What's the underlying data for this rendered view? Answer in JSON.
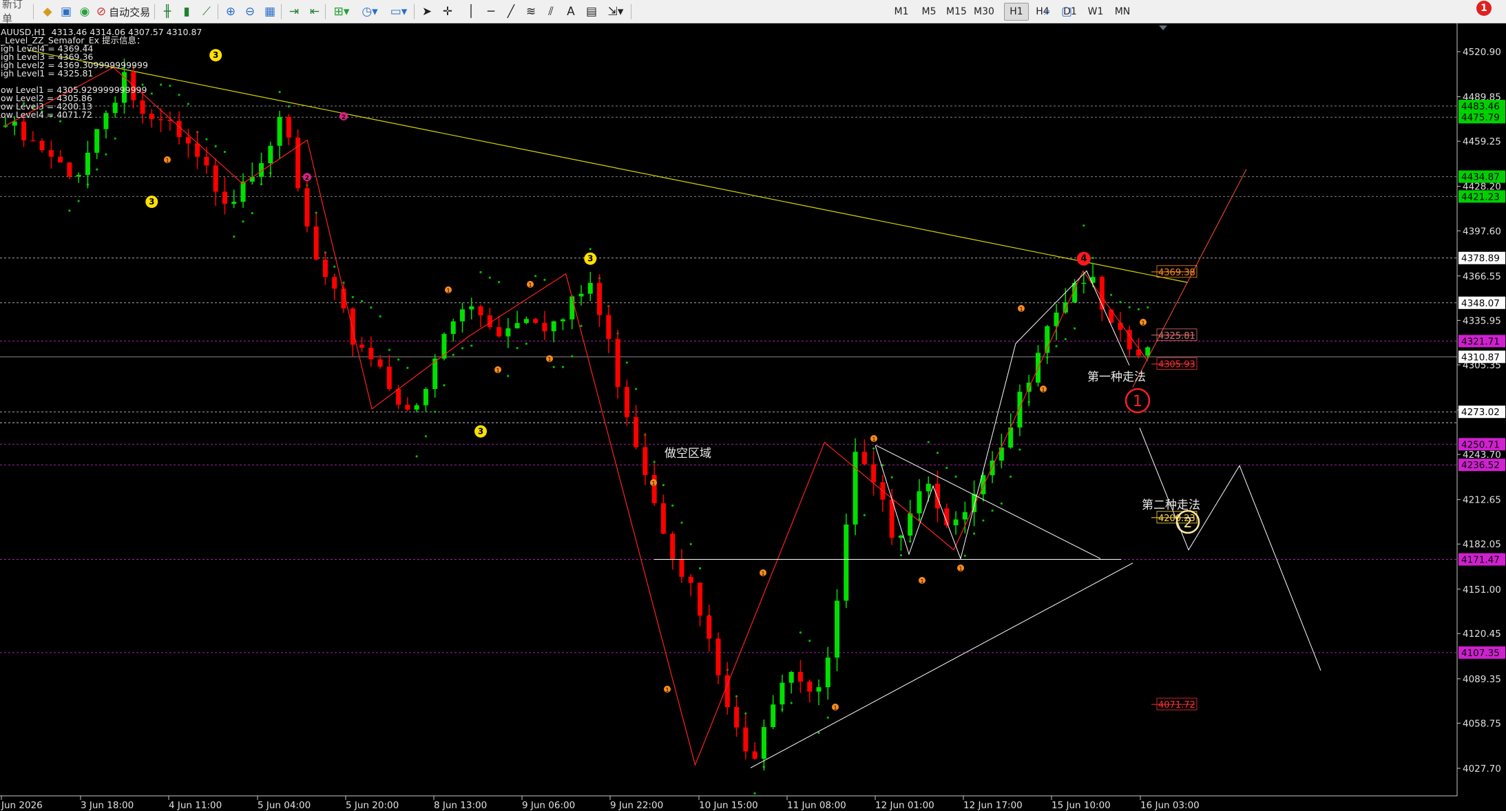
{
  "toolbar": {
    "new_order": "新订单",
    "auto_trading": "自动交易",
    "timeframes": [
      "M1",
      "M5",
      "M15",
      "M30",
      "H1",
      "H4",
      "D1",
      "W1",
      "MN"
    ],
    "active_timeframe": "H1",
    "alert_count": "1",
    "icons": [
      "new-order-icon",
      "metaeditor-icon",
      "navigator-icon",
      "market-watch-icon",
      "auto-trading-icon",
      "bar-chart-icon",
      "candlestick-icon",
      "line-chart-icon",
      "zoom-in-icon",
      "zoom-out-icon",
      "tile-icon",
      "chart-shift-icon",
      "autoscroll-icon",
      "indicators-icon",
      "periods-icon",
      "templates-icon",
      "cursor-icon",
      "crosshair-icon",
      "vertical-line-icon",
      "horizontal-line-icon",
      "trendline-icon",
      "fibo-icon",
      "channel-icon",
      "text-icon",
      "label-icon",
      "arrows-icon",
      "search-icon",
      "chat-icon"
    ]
  },
  "chart_header": {
    "symbol_line": "AUUSD,H1  4313.46 4314.06 4307.57 4310.87",
    "indicator_name": "_Level_ZZ_Semafor_Ex 提示信息：",
    "levels": [
      "igh Level4 = 4369.44",
      "igh Level3 = 4369.36",
      "igh Level2 = 4369.309999999999",
      "igh Level1 = 4325.81",
      "",
      "ow Level1 = 4305.929999999999",
      "ow Level2 = 4305.86",
      "ow Level3 = 4200.13",
      "ow Level4 = 4071.72"
    ]
  },
  "price_axis": {
    "ticks": [
      "4520.90",
      "4489.85",
      "4459.25",
      "4428.20",
      "4397.60",
      "4366.55",
      "4335.95",
      "4305.35",
      "4274.30",
      "4243.70",
      "4212.65",
      "4182.05",
      "4151.00",
      "4120.45",
      "4089.35",
      "4058.75",
      "4027.70"
    ],
    "tick_values": [
      4520.9,
      4489.85,
      4459.25,
      4428.2,
      4397.6,
      4366.55,
      4335.95,
      4305.35,
      4274.3,
      4243.7,
      4212.65,
      4182.05,
      4151.0,
      4120.45,
      4089.35,
      4058.75,
      4027.7
    ],
    "tags": [
      {
        "text": "4483.46",
        "value": 4483.46,
        "color": "#00d000"
      },
      {
        "text": "4475.79",
        "value": 4475.79,
        "color": "#00d000"
      },
      {
        "text": "4434.87",
        "value": 4434.87,
        "color": "#00d000"
      },
      {
        "text": "4421.23",
        "value": 4421.23,
        "color": "#00d000"
      },
      {
        "text": "4378.89",
        "value": 4378.89,
        "color": "#ffffff"
      },
      {
        "text": "4348.07",
        "value": 4348.07,
        "color": "#ffffff"
      },
      {
        "text": "4321.71",
        "value": 4321.71,
        "color": "#d020d0"
      },
      {
        "text": "4310.87",
        "value": 4310.87,
        "color": "#ffffff"
      },
      {
        "text": "4273.02",
        "value": 4273.02,
        "color": "#ffffff"
      },
      {
        "text": "4250.71",
        "value": 4250.71,
        "color": "#d020d0"
      },
      {
        "text": "4236.52",
        "value": 4236.52,
        "color": "#d020d0"
      },
      {
        "text": "4171.47",
        "value": 4171.47,
        "color": "#d020d0"
      },
      {
        "text": "4107.35",
        "value": 4107.35,
        "color": "#d020d0"
      }
    ]
  },
  "time_axis": {
    "labels": [
      "Jun 2026",
      "3 Jun 18:00",
      "4 Jun 11:00",
      "5 Jun 04:00",
      "5 Jun 20:00",
      "8 Jun 13:00",
      "9 Jun 06:00",
      "9 Jun 22:00",
      "10 Jun 15:00",
      "11 Jun 08:00",
      "12 Jun 01:00",
      "12 Jun 17:00",
      "15 Jun 10:00",
      "16 Jun 03:00"
    ]
  },
  "level_boxes": [
    {
      "text": "4369.38",
      "value": 4369.38,
      "color": "#ff8c1a"
    },
    {
      "text": "4325.81",
      "value": 4325.81,
      "color": "#e07070"
    },
    {
      "text": "4305.93",
      "value": 4305.93,
      "color": "#ff3030"
    },
    {
      "text": "4200.23",
      "value": 4200.23,
      "color": "#ffd84a"
    },
    {
      "text": "4071.72",
      "value": 4071.72,
      "color": "#ff3030"
    }
  ],
  "annotations": {
    "short_zone": "做空区域",
    "scenario_one": "第一种走法",
    "scenario_two": "第二种走法",
    "marker_one": "1",
    "marker_two": "2"
  },
  "semafor_labels": [
    "1",
    "2",
    "3",
    "4"
  ],
  "colors": {
    "background": "#000000",
    "bull_candle": "#00e000",
    "bear_candle": "#ff0000",
    "grid_dotted": "#c8c8c8",
    "magenta_level": "#d020d0",
    "trendline": "#d8d800",
    "zigzag": "#ff2020",
    "projection_white": "#ffffff",
    "parabolic_sar": "#00c000"
  },
  "chart_data": {
    "type": "candlestick",
    "symbol": "AUUSD",
    "timeframe": "H1",
    "current_price": 4310.87,
    "ylim": [
      4018,
      4532
    ],
    "x_labels": [
      "Jun 2026",
      "3 Jun 18:00",
      "4 Jun 11:00",
      "5 Jun 04:00",
      "5 Jun 20:00",
      "8 Jun 13:00",
      "9 Jun 06:00",
      "9 Jun 22:00",
      "10 Jun 15:00",
      "11 Jun 08:00",
      "12 Jun 01:00",
      "12 Jun 17:00",
      "15 Jun 10:00",
      "16 Jun 03:00"
    ],
    "price_path": [
      4470,
      4462,
      4455,
      4448,
      4440,
      4432,
      4452,
      4470,
      4488,
      4508,
      4478,
      4466,
      4472,
      4460,
      4448,
      4438,
      4428,
      4420,
      4438,
      4448,
      4462,
      4470,
      4425,
      4385,
      4362,
      4345,
      4325,
      4318,
      4308,
      4292,
      4280,
      4270,
      4295,
      4325,
      4338,
      4345,
      4340,
      4330,
      4332,
      4345,
      4340,
      4333,
      4336,
      4350,
      4362,
      4330,
      4300,
      4268,
      4240,
      4210,
      4185,
      4165,
      4140,
      4110,
      4080,
      4050,
      4030,
      4060,
      4085,
      4100,
      4092,
      4080,
      4098,
      4170,
      4240,
      4225,
      4205,
      4190,
      4205,
      4230,
      4218,
      4200,
      4190,
      4215,
      4230,
      4240,
      4270,
      4300,
      4330,
      4345,
      4355,
      4370,
      4355,
      4330,
      4320,
      4312,
      4310.87
    ],
    "zigzag": [
      [
        0,
        4470
      ],
      [
        10,
        4510
      ],
      [
        22,
        4430
      ],
      [
        28,
        4460
      ],
      [
        34,
        4275
      ],
      [
        43,
        4325
      ],
      [
        52,
        4368
      ],
      [
        64,
        4030
      ],
      [
        76,
        4252
      ],
      [
        88,
        4178
      ],
      [
        100,
        4370
      ],
      [
        106,
        4308
      ]
    ],
    "semafor": [
      {
        "label": "3",
        "i": 16,
        "price": 4428,
        "pos": "below"
      },
      {
        "label": "3",
        "i": 23,
        "price": 4508,
        "pos": "above"
      },
      {
        "label": "2",
        "i": 33,
        "price": 4445,
        "pos": "below"
      },
      {
        "label": "2",
        "i": 37,
        "price": 4466,
        "pos": "above"
      },
      {
        "label": "3",
        "i": 52,
        "price": 4270,
        "pos": "below"
      },
      {
        "label": "3",
        "i": 64,
        "price": 4368,
        "pos": "above"
      },
      {
        "label": "4",
        "i": 118,
        "price": 4368,
        "pos": "above"
      }
    ]
  }
}
